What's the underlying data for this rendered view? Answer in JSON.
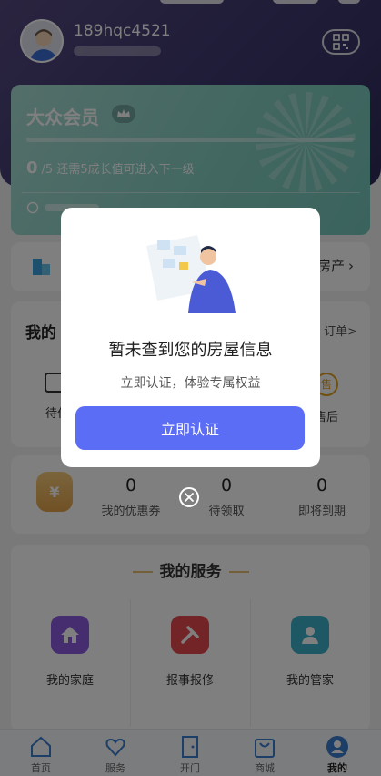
{
  "header": {
    "username": "189hqc4521"
  },
  "member_card": {
    "level_title": "大众会员",
    "growth_value": "0",
    "growth_text": "/5 还需5成长值可进入下一级",
    "progress_fraction": 0.0
  },
  "house_row": {
    "right_label": "房产"
  },
  "orders": {
    "title": "我的",
    "view_all": "订单>",
    "items": [
      {
        "label": "待付"
      },
      {
        "label": "售后",
        "badge": "售"
      }
    ]
  },
  "coupons": {
    "stats": [
      {
        "value": "0",
        "label": "我的优惠券"
      },
      {
        "value": "0",
        "label": "待领取"
      },
      {
        "value": "0",
        "label": "即将到期"
      }
    ],
    "coupon_icon_text": "¥"
  },
  "services": {
    "title": "我的服务",
    "items": [
      {
        "label": "我的家庭",
        "icon": "home-icon",
        "color": "#8a5be0"
      },
      {
        "label": "报事报修",
        "icon": "wrench-icon",
        "color": "#e4494e"
      },
      {
        "label": "我的管家",
        "icon": "butler-icon",
        "color": "#3bb0c9"
      }
    ]
  },
  "tabbar": {
    "tabs": [
      {
        "label": "首页",
        "icon": "home-tab-icon",
        "active": false
      },
      {
        "label": "服务",
        "icon": "heart-hand-icon",
        "active": false
      },
      {
        "label": "开门",
        "icon": "door-icon",
        "active": false
      },
      {
        "label": "商城",
        "icon": "shopping-bag-icon",
        "active": false
      },
      {
        "label": "我的",
        "icon": "profile-icon",
        "active": true
      }
    ]
  },
  "modal": {
    "title": "暂未查到您的房屋信息",
    "description": "立即认证，体验专属权益",
    "button_label": "立即认证"
  },
  "colors": {
    "header": "#3f3a72",
    "card": "#86cfc3",
    "primary_button": "#5b6cf5",
    "accent_line": "#e7c070"
  }
}
